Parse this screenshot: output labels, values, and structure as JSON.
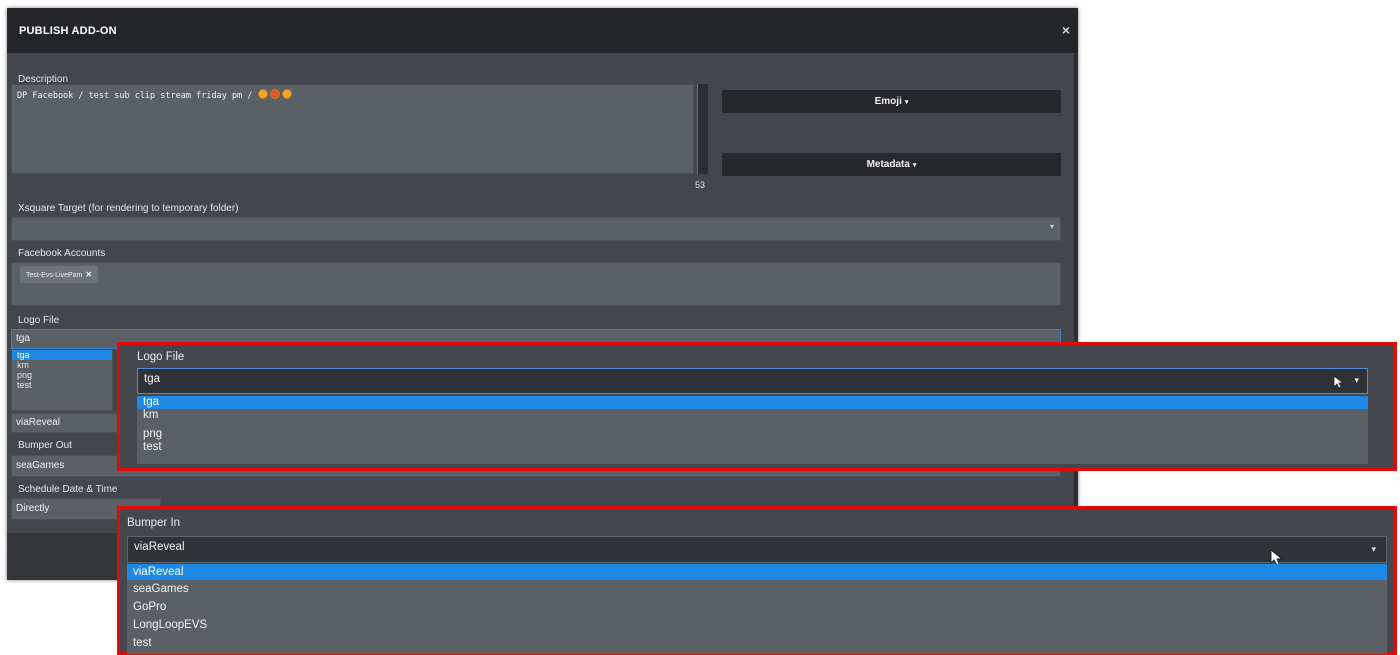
{
  "dialog": {
    "title": "PUBLISH ADD-ON",
    "close": "×"
  },
  "description": {
    "label": "Description",
    "text": "DP Facebook / test sub clip stream friday pm /",
    "counter": "53"
  },
  "side_buttons": {
    "emoji": "Emoji",
    "metadata": "Metadata",
    "caret": "▾"
  },
  "xsquare": {
    "label": "Xsquare Target (for rendering to temporary folder)",
    "value": ""
  },
  "facebook": {
    "label": "Facebook Accounts",
    "chip": "Test-Evs-LivePam",
    "chip_remove": "✕"
  },
  "logo": {
    "label": "Logo File",
    "value": "tga",
    "options": [
      "tga",
      "km",
      "png",
      "test"
    ]
  },
  "bumper_in": {
    "label": "Bumper In",
    "value": "viaReveal",
    "options": [
      "viaReveal",
      "seaGames",
      "GoPro",
      "LongLoopEVS",
      "test"
    ]
  },
  "bumper_out": {
    "label": "Bumper Out",
    "value": "seaGames"
  },
  "schedule": {
    "label": "Schedule Date & Time",
    "value": "Directly"
  },
  "colors": {
    "highlight": "#1e88e5",
    "callout_border": "#e10a0a",
    "header_bg": "#232528"
  }
}
